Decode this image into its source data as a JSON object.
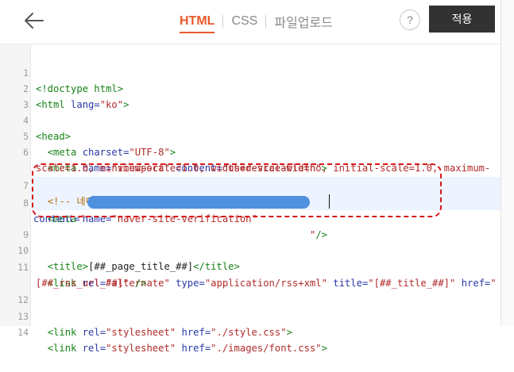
{
  "header": {
    "back_icon": "arrow-left-icon",
    "tabs": [
      {
        "label": "HTML",
        "active": true
      },
      {
        "label": "CSS",
        "active": false
      },
      {
        "label": "파일업로드",
        "active": false
      }
    ],
    "help_label": "?",
    "apply_label": "적용",
    "accent_color": "#e85a2a"
  },
  "editor": {
    "line_numbers": [
      "1",
      "2",
      "3",
      "4",
      "5",
      "6",
      "7",
      "8",
      "9",
      "10",
      "11",
      "12",
      "13",
      "14"
    ],
    "lines": {
      "l1": {
        "t1": "<!doctype html>"
      },
      "l2": {
        "t1": "<html ",
        "a1": "lang=",
        "s1": "\"ko\"",
        "t2": ">"
      },
      "l4": {
        "t1": "<head>"
      },
      "l5": {
        "t1": "<meta ",
        "a1": "charset=",
        "s1": "\"UTF-8\"",
        "t2": ">"
      },
      "l6": {
        "t1": "<meta ",
        "a1": "name=",
        "s1": "\"viewport\"",
        "a2": " content=",
        "s2": "\"user-scalable=no, initial-scale=1.0, maximum-"
      },
      "l6b": {
        "s1": "scale=1.0, minimum-scale=1.0, width=device-width\"",
        "t1": ">"
      },
      "l7": {
        "c1": "<!-- 네이버 소유권 확인 -->"
      },
      "l8": {
        "t1": "<meta ",
        "a1": "name=",
        "s1": "\"naver-site-verification\""
      },
      "l8b": {
        "a1": "content=",
        "s1": "\"",
        "s2": "\"",
        "t1": "/>"
      },
      "l10": {
        "t1": "<title>",
        "p1": "[##_page_title_##]",
        "t2": "</title>"
      },
      "l11": {
        "t1": "<link ",
        "a1": "rel=",
        "s1": "\"alternate\"",
        "a2": " type=",
        "s2": "\"application/rss+xml\"",
        "a3": " title=",
        "s3": "\"[##_title_##]\"",
        "a4": " href=",
        "s4": "\""
      },
      "l11b": {
        "s1": "[##_rss_url_##]\"",
        "t1": " />"
      },
      "l13": {
        "t1": "<link ",
        "a1": "rel=",
        "s1": "\"stylesheet\"",
        "a2": " href=",
        "s2": "\"./style.css\"",
        "t2": ">"
      },
      "l14": {
        "t1": "<link ",
        "a1": "rel=",
        "s1": "\"stylesheet\"",
        "a2": " href=",
        "s2": "\"./images/font.css\"",
        "t2": ">"
      }
    }
  }
}
